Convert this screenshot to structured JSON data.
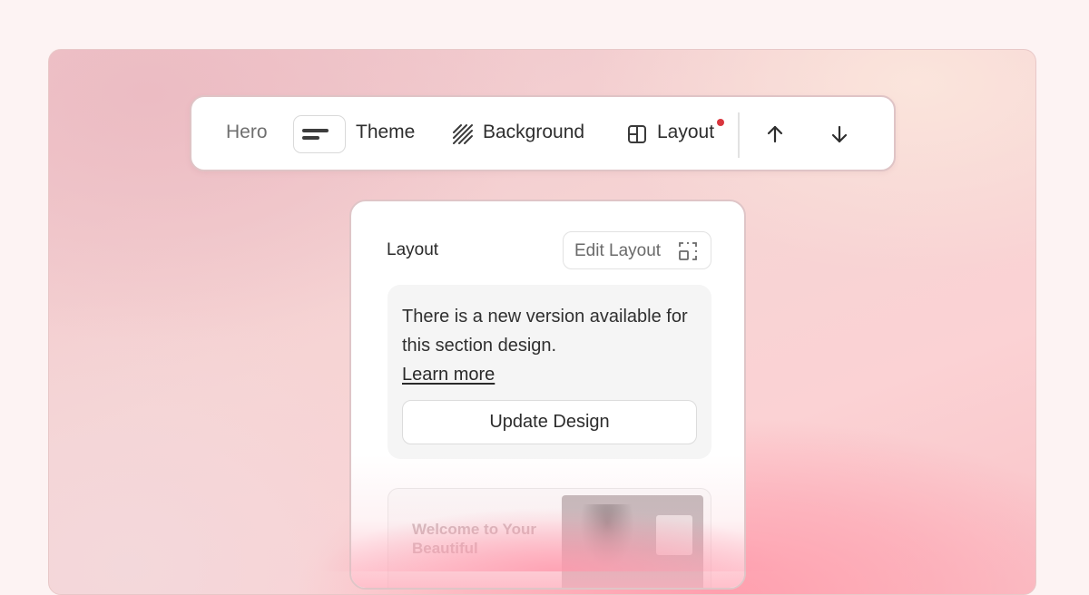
{
  "toolbar": {
    "section_label": "Hero",
    "theme_label": "Theme",
    "background_label": "Background",
    "layout_label": "Layout",
    "layout_has_notification": true,
    "notification_color": "#d9363e",
    "icons": {
      "theme": "theme-swatch-icon",
      "background": "diagonal-stripes-icon",
      "layout": "layout-grid-icon",
      "move_up": "arrow-up-icon",
      "move_down": "arrow-down-icon"
    }
  },
  "panel": {
    "title": "Layout",
    "edit_button_label": "Edit Layout",
    "edit_icon": "dashed-frame-icon",
    "notice": {
      "message": "There is a new version available for this section design.",
      "link_label": "Learn more",
      "button_label": "Update Design"
    },
    "preview": {
      "heading": "Welcome to Your Beautiful"
    }
  },
  "colors": {
    "accent_background": "#f9c3c8",
    "text": "#2e2e2e"
  }
}
